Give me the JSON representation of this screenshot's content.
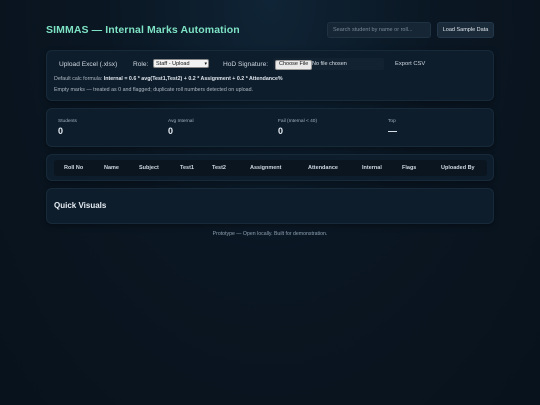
{
  "header": {
    "title": "SIMMAS — Internal Marks Automation",
    "search_placeholder": "Search student by name or roll...",
    "load_sample_label": "Load Sample Data"
  },
  "controls": {
    "upload_label": "Upload Excel (.xlsx)",
    "role_label": "Role:",
    "role_selected": "Staff - Upload",
    "hod_label": "HoD Signature:",
    "choose_file_label": "Choose File",
    "no_file_text": "No file chosen",
    "export_label": "Export CSV",
    "formula_prefix": "Default calc formula:",
    "formula": "Internal = 0.6 * avg(Test1,Test2) + 0.2 * Assignment + 0.2 * Attendance%",
    "empty_note": "Empty marks — treated as 0 and flagged; duplicate roll numbers detected on upload."
  },
  "stats": [
    {
      "label": "Students",
      "value": "0"
    },
    {
      "label": "Avg Internal",
      "value": "0"
    },
    {
      "label": "Fail (Internal < 40)",
      "value": "0"
    },
    {
      "label": "Top",
      "value": "—"
    }
  ],
  "table": {
    "columns": [
      "Roll No",
      "Name",
      "Subject",
      "Test1",
      "Test2",
      "Assignment",
      "Attendance",
      "Internal",
      "Flags",
      "Uploaded By"
    ]
  },
  "visuals": {
    "title": "Quick Visuals"
  },
  "footer": {
    "text": "Prototype — Open locally. Built for demonstration."
  }
}
